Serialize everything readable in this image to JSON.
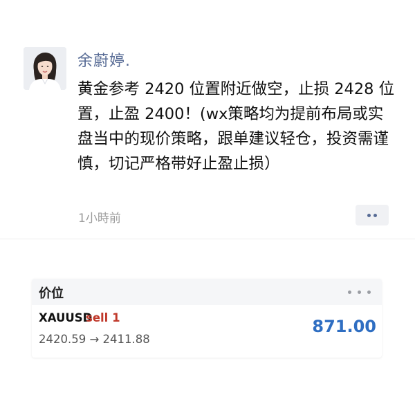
{
  "post": {
    "author": "余蔚婷.",
    "text": "黄金参考 2420 位置附近做空，止损 2428 位置，止盈 2400！(wx策略均为提前布局或实盘当中的现价策略，跟单建议轻仓，投资需谨慎，切记严格带好止盈止损）",
    "timestamp": "1小時前"
  },
  "trade_card": {
    "title": "价位",
    "symbol": "XAUUSD",
    "side": "sell 1",
    "price_range": "2420.59 → 2411.88",
    "profit": "871.00"
  },
  "colors": {
    "author": "#576b95",
    "sell": "#c0392b",
    "profit": "#2f6ec2"
  },
  "icons": [
    "avatar-photo",
    "more-dots-icon",
    "card-menu-icon"
  ]
}
